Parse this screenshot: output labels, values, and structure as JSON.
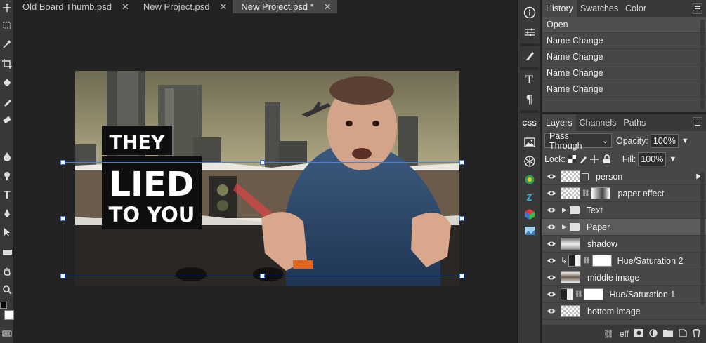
{
  "tabs": [
    {
      "label": "Old Board Thumb.psd",
      "close": "✕"
    },
    {
      "label": "New Project.psd",
      "close": "✕"
    },
    {
      "label": "New Project.psd *",
      "close": "✕"
    }
  ],
  "tools": [
    "move-tool-icon",
    "marquee-tool-icon",
    "magic-wand-icon",
    "crop-tool-icon",
    "healing-brush-icon",
    "brush-tool-icon",
    "eraser-tool-icon",
    "fill-tool-icon",
    "blur-tool-icon",
    "dodge-tool-icon",
    "type-tool-icon",
    "pen-tool-icon",
    "path-select-icon",
    "rectangle-tool-icon",
    "hand-tool-icon",
    "zoom-tool-icon"
  ],
  "thumbnail": {
    "line1": "THEY",
    "line2": "LIED",
    "line3": "TO YOU"
  },
  "strip": {
    "css_label": "CSS",
    "type_label": "T",
    "para_label": "¶"
  },
  "history": {
    "tabs": [
      "History",
      "Swatches",
      "Color"
    ],
    "rows": [
      "Open",
      "Name Change",
      "Name Change",
      "Name Change",
      "Name Change"
    ]
  },
  "layers": {
    "tabs": [
      "Layers",
      "Channels",
      "Paths"
    ],
    "blend_mode": "Pass Through",
    "opacity_label": "Opacity:",
    "opacity_value": "100%",
    "lock_label": "Lock:",
    "fill_label": "Fill:",
    "fill_value": "100%",
    "rows": [
      {
        "name": "person"
      },
      {
        "name": "paper effect"
      },
      {
        "name": "Text"
      },
      {
        "name": "Paper"
      },
      {
        "name": "shadow"
      },
      {
        "name": "Hue/Saturation 2"
      },
      {
        "name": "middle image"
      },
      {
        "name": "Hue/Saturation 1"
      },
      {
        "name": "bottom image"
      }
    ],
    "footer": {
      "fx_label": "eff"
    }
  },
  "colors": {
    "selection": "#4d7fd6",
    "panel_bg": "#474747",
    "app_bg": "#232323"
  }
}
